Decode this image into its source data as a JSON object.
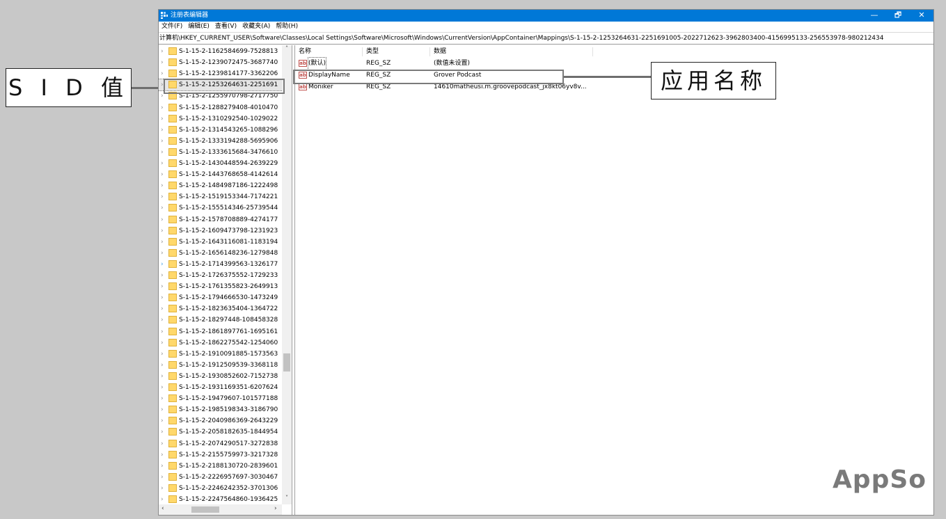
{
  "window": {
    "title": "注册表编辑器",
    "controls": {
      "minimize": "—",
      "maximize": "🗗",
      "close": "✕"
    },
    "accent_color": "#0078d7"
  },
  "menu": [
    "文件(F)",
    "编辑(E)",
    "查看(V)",
    "收藏夹(A)",
    "帮助(H)"
  ],
  "address": "计算机\\HKEY_CURRENT_USER\\Software\\Classes\\Local Settings\\Software\\Microsoft\\Windows\\CurrentVersion\\AppContainer\\Mappings\\S-1-15-2-1253264631-2251691005-2022712623-3962803400-4156995133-256553978-980212434",
  "tree": {
    "selected_index": 3,
    "items": [
      {
        "label": "S-1-15-2-1162584699-7528813"
      },
      {
        "label": "S-1-15-2-1239072475-3687740"
      },
      {
        "label": "S-1-15-2-1239814177-3362206"
      },
      {
        "label": "S-1-15-2-1253264631-2251691"
      },
      {
        "label": "S-1-15-2-1255970798-2717750"
      },
      {
        "label": "S-1-15-2-1288279408-4010470"
      },
      {
        "label": "S-1-15-2-1310292540-1029022"
      },
      {
        "label": "S-1-15-2-1314543265-1088296"
      },
      {
        "label": "S-1-15-2-1333194288-5695906"
      },
      {
        "label": "S-1-15-2-1333615684-3476610"
      },
      {
        "label": "S-1-15-2-1430448594-2639229"
      },
      {
        "label": "S-1-15-2-1443768658-4142614"
      },
      {
        "label": "S-1-15-2-1484987186-1222498"
      },
      {
        "label": "S-1-15-2-1519153344-7174221"
      },
      {
        "label": "S-1-15-2-155514346-25739544"
      },
      {
        "label": "S-1-15-2-1578708889-4274177"
      },
      {
        "label": "S-1-15-2-1609473798-1231923"
      },
      {
        "label": "S-1-15-2-1643116081-1183194"
      },
      {
        "label": "S-1-15-2-1656148236-1279848"
      },
      {
        "label": "S-1-15-2-1714399563-1326177"
      },
      {
        "label": "S-1-15-2-1726375552-1729233"
      },
      {
        "label": "S-1-15-2-1761355823-2649913"
      },
      {
        "label": "S-1-15-2-1794666530-1473249"
      },
      {
        "label": "S-1-15-2-1823635404-1364722"
      },
      {
        "label": "S-1-15-2-18297448-108458328"
      },
      {
        "label": "S-1-15-2-1861897761-1695161"
      },
      {
        "label": "S-1-15-2-1862275542-1254060"
      },
      {
        "label": "S-1-15-2-1910091885-1573563"
      },
      {
        "label": "S-1-15-2-1912509539-3368118"
      },
      {
        "label": "S-1-15-2-1930852602-7152738"
      },
      {
        "label": "S-1-15-2-1931169351-6207624"
      },
      {
        "label": "S-1-15-2-19479607-101577188"
      },
      {
        "label": "S-1-15-2-1985198343-3186790"
      },
      {
        "label": "S-1-15-2-2040986369-2643229"
      },
      {
        "label": "S-1-15-2-2058182635-1844954"
      },
      {
        "label": "S-1-15-2-2074290517-3272838"
      },
      {
        "label": "S-1-15-2-2155759973-3217328"
      },
      {
        "label": "S-1-15-2-2188130720-2839601"
      },
      {
        "label": "S-1-15-2-2226957697-3030467"
      },
      {
        "label": "S-1-15-2-2246242352-3701306"
      },
      {
        "label": "S-1-15-2-2247564860-1936425"
      }
    ]
  },
  "values": {
    "columns": [
      "名称",
      "类型",
      "数据"
    ],
    "rows": [
      {
        "name": "(默认)",
        "type": "REG_SZ",
        "data": "(数值未设置)"
      },
      {
        "name": "DisplayName",
        "type": "REG_SZ",
        "data": "Grover Podcast"
      },
      {
        "name": "Moniker",
        "type": "REG_SZ",
        "data": "14610matheusi.m.groovepodcast_jx8kt06yv8v..."
      }
    ]
  },
  "annotations": {
    "sid_label": "S I D 值",
    "app_name_label": "应用名称",
    "highlight_color": "#7a7a7a"
  },
  "watermark": "AppSo"
}
